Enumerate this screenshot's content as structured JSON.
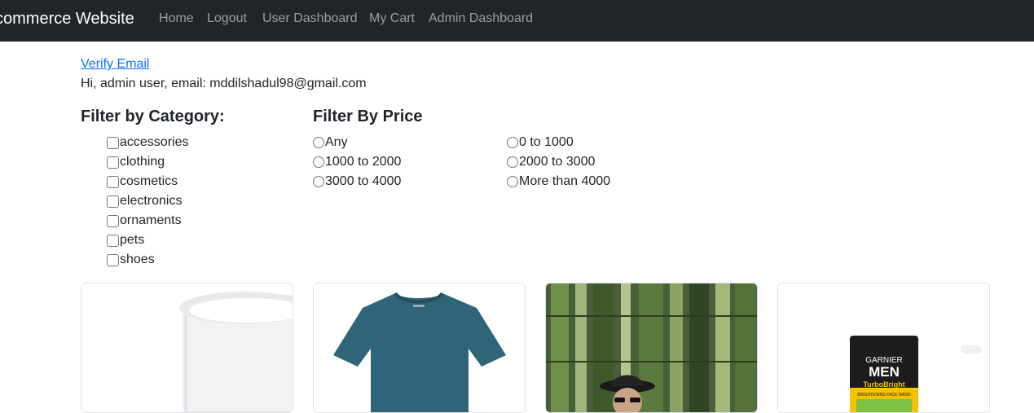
{
  "navbar": {
    "brand": "commerce Website",
    "links": [
      "Home",
      "Logout",
      "User Dashboard",
      "My Cart",
      "Admin Dashboard"
    ]
  },
  "account": {
    "verify_link": "Verify Email",
    "greeting": "Hi, admin user, email: mddilshadul98@gmail.com"
  },
  "category_filter": {
    "heading": "Filter by Category:",
    "items": [
      "accessories",
      "clothing",
      "cosmetics",
      "electronics",
      "ornaments",
      "pets",
      "shoes"
    ]
  },
  "price_filter": {
    "heading": "Filter By Price",
    "options": [
      "Any",
      "0 to 1000",
      "1000 to 2000",
      "2000 to 3000",
      "3000 to 4000",
      "More than 4000"
    ]
  },
  "products": [
    {
      "image": "white-mug-image"
    },
    {
      "image": "teal-tshirt-image"
    },
    {
      "image": "man-in-bamboo-forest-image"
    },
    {
      "image": "garnier-men-face-wash-image",
      "logo_text": [
        "GARNIER",
        "MEN",
        "TurboBright",
        "BRIGHTENING FACE WASH"
      ]
    }
  ],
  "colors": {
    "navbar_bg": "#212529",
    "link_blue": "#0d6efd",
    "tshirt": "#2f6578"
  }
}
